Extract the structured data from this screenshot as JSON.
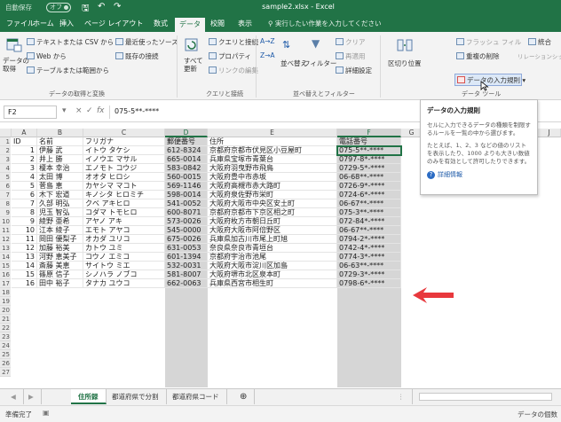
{
  "title_bar": {
    "autosave": "自動保存",
    "autosave_state": "オフ",
    "save_icon": "save-icon",
    "title": "sample2.xlsx  -  Excel"
  },
  "tabs": [
    "ファイル",
    "ホーム",
    "挿入",
    "ページ レイアウト",
    "数式",
    "データ",
    "校閲",
    "表示"
  ],
  "active_tab": "データ",
  "tell_me": "実行したい作業を入力してください",
  "ribbon": {
    "get_data": "データの\n取得",
    "from_text": "テキストまたは CSV から",
    "from_web": "Web から",
    "from_table": "テーブルまたは範囲から",
    "recent_sources": "最近使ったソース",
    "existing_connections": "既存の接続",
    "group1": "データの取得と変換",
    "refresh_all": "すべて\n更新",
    "queries": "クエリと接続",
    "properties": "プロパティ",
    "edit_links": "リンクの編集",
    "group2": "クエリと接続",
    "sort_az": "A→Z",
    "sort_za": "Z→A",
    "sort": "並べ替え",
    "filter": "フィルター",
    "clear": "クリア",
    "reapply": "再適用",
    "advanced": "詳細設定",
    "group3": "並べ替えとフィルター",
    "text_to_columns": "区切り位置",
    "flash_fill": "フラッシュ フィル",
    "remove_duplicates": "重複の削除",
    "data_validation": "データの入力規則",
    "consolidate": "統合",
    "relationships": "リレーションシップ",
    "group4": "データ ツール"
  },
  "formula_bar": {
    "name_box": "F2",
    "cancel": "×",
    "enter": "✓",
    "fx": "fx",
    "formula": "075-5**-****"
  },
  "columns": [
    "A",
    "B",
    "C",
    "D",
    "E",
    "F",
    "G",
    "J"
  ],
  "header_row": [
    "ID",
    "名前",
    "フリガナ",
    "郵便番号",
    "住所",
    "電話番号"
  ],
  "rows": [
    [
      "1",
      "伊藤 武",
      "イトウ タケシ",
      "612-8324",
      "京都府京都市伏見区小豆屋町",
      "075-5**-****"
    ],
    [
      "2",
      "井上 勝",
      "イノウエ マサル",
      "665-0014",
      "兵庫県宝塚市青葉台",
      "0797-8*-****"
    ],
    [
      "3",
      "榎本 幸治",
      "エノモト コウジ",
      "583-0842",
      "大阪府羽曳野市飛鳥",
      "0729-5*-****"
    ],
    [
      "4",
      "太田 博",
      "オオタ ヒロシ",
      "560-0015",
      "大阪府豊中市赤坂",
      "06-68**-****"
    ],
    [
      "5",
      "菅島 恵",
      "カヤシマ マコト",
      "569-1146",
      "大阪府高槻市赤大路町",
      "0726-9*-****"
    ],
    [
      "6",
      "木下 宏道",
      "キノシタ ヒロミチ",
      "598-0014",
      "大阪府泉佐野市栄町",
      "0724-6*-****"
    ],
    [
      "7",
      "久部 明弘",
      "クベ アキヒロ",
      "541-0052",
      "大阪府大阪市中央区安土町",
      "06-67**-****"
    ],
    [
      "8",
      "児玉 智弘",
      "コダマ トモヒロ",
      "600-8071",
      "京都府京都市下京区相之町",
      "075-3**-****"
    ],
    [
      "9",
      "綾野 亜希",
      "アヤノ アキ",
      "573-0026",
      "大阪府枚方市朝日丘町",
      "072-84*-****"
    ],
    [
      "10",
      "江本 綾子",
      "エモト アヤコ",
      "545-0000",
      "大阪府大阪市阿倍野区",
      "06-67**-****"
    ],
    [
      "11",
      "岡田 優梨子",
      "オカダ ユリコ",
      "675-0026",
      "兵庫県加古川市尾上町旭",
      "0794-2*-****"
    ],
    [
      "12",
      "加藤 裕美",
      "カトウ ユミ",
      "631-0053",
      "奈良県奈良市青垣台",
      "0742-4*-****"
    ],
    [
      "13",
      "河野 恵美子",
      "コウノ エミコ",
      "601-1394",
      "京都府宇治市池尾",
      "0774-3*-****"
    ],
    [
      "14",
      "斎藤 美恵",
      "サイトウ ミエ",
      "532-0031",
      "大阪府大阪市淀川区加島",
      "06-63**-****"
    ],
    [
      "15",
      "篠原 信子",
      "シノハラ ノブコ",
      "581-8007",
      "大阪府堺市北区泉本町",
      "0729-3*-****"
    ],
    [
      "16",
      "田中 裕子",
      "タナカ ユウコ",
      "662-0063",
      "兵庫県西宮市相生町",
      "0798-6*-****"
    ]
  ],
  "row_numbers": [
    "1",
    "2",
    "3",
    "4",
    "5",
    "6",
    "7",
    "8",
    "9",
    "10",
    "11",
    "12",
    "13",
    "14",
    "15",
    "16",
    "17",
    "18",
    "19",
    "20",
    "21",
    "22",
    "23",
    "24",
    "25",
    "26",
    "27"
  ],
  "tooltip": {
    "title": "データの入力規則",
    "body1": "セルに入力できるデータの種類を制限するルールを一覧の中から選びます。",
    "body2": "たとえば、1、2、3 などの値のリストを表示したり、1000 よりも大きい数値のみを有効として許可したりできます。",
    "link": "詳細情報"
  },
  "sheet_tabs": [
    "住所録",
    "都道府県で分割",
    "都道府県コード"
  ],
  "active_sheet": "住所録",
  "status": {
    "ready": "準備完了",
    "right": "データの個数"
  },
  "colors": {
    "brand": "#217346",
    "arrow": "#e8383d"
  }
}
